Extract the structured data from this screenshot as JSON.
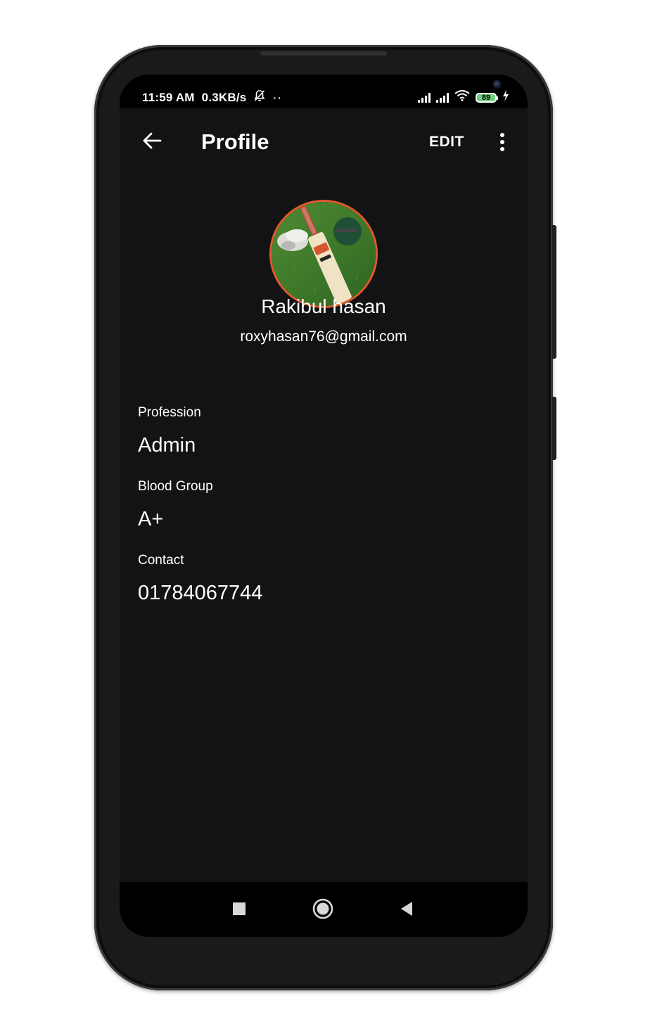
{
  "status_bar": {
    "time": "11:59 AM",
    "net_speed": "0.3KB/s",
    "more_indicator": "··",
    "battery_level": "89",
    "icons": [
      "bell-off-icon",
      "signal-icon",
      "signal-icon",
      "wifi-icon",
      "battery-icon",
      "charging-bolt-icon"
    ]
  },
  "toolbar": {
    "back_icon": "arrow-left-icon",
    "title": "Profile",
    "edit_label": "EDIT",
    "more_icon": "more-vertical-icon"
  },
  "profile": {
    "name": "Rakibul hasan",
    "email": "roxyhasan76@gmail.com",
    "avatar_border_color": "#e05a2b"
  },
  "fields": {
    "profession_label": "Profession",
    "profession_value": "Admin",
    "blood_group_label": "Blood Group",
    "blood_group_value": "A+",
    "contact_label": "Contact",
    "contact_value": "01784067744"
  },
  "nav_bar": {
    "icons": [
      "recents-square-icon",
      "home-circle-icon",
      "back-triangle-icon"
    ]
  },
  "colors": {
    "app_background": "#131315",
    "system_bars": "#000000",
    "text": "#ffffff",
    "battery_fill": "#6cd17a"
  }
}
